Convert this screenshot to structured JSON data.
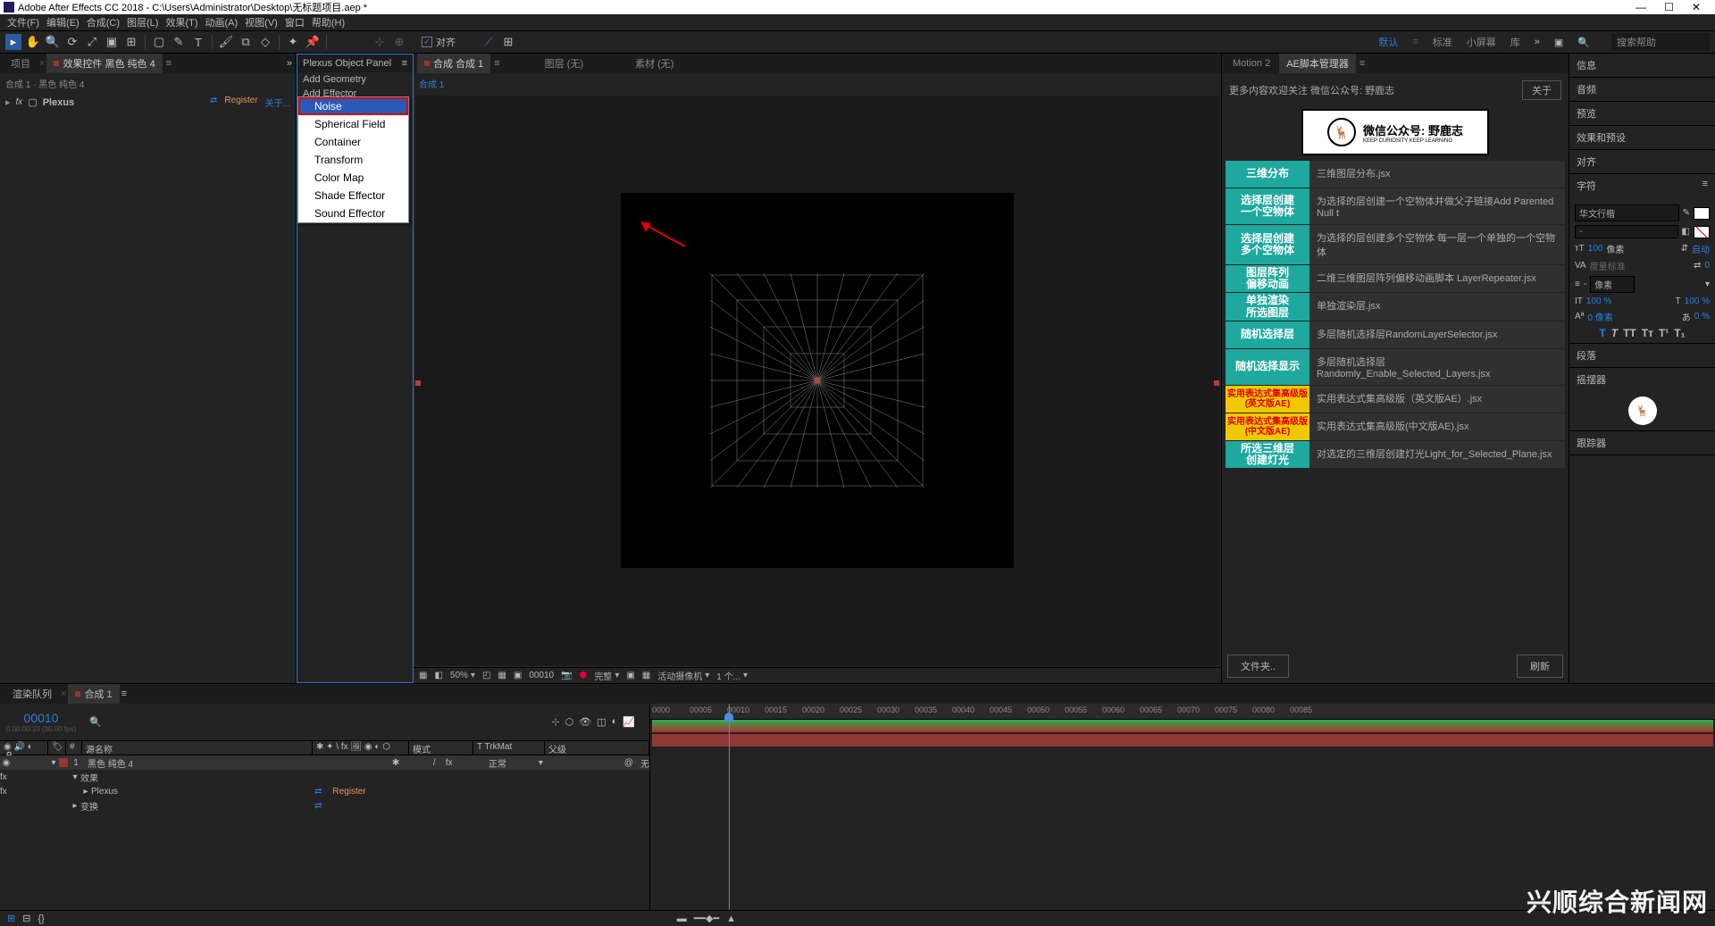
{
  "title_bar": {
    "text": "Adobe After Effects CC 2018 - C:\\Users\\Administrator\\Desktop\\无标题项目.aep *"
  },
  "menu": [
    "文件(F)",
    "编辑(E)",
    "合成(C)",
    "图层(L)",
    "效果(T)",
    "动画(A)",
    "视图(V)",
    "窗口",
    "帮助(H)"
  ],
  "toolbar": {
    "align_label": "对齐"
  },
  "workspaces": {
    "items": [
      "默认",
      "标准",
      "小屏幕",
      "库"
    ],
    "active": 0,
    "search_placeholder": "搜索帮助"
  },
  "project_panel": {
    "tabs": {
      "project": "项目",
      "effect_controls": "效果控件 黑色 纯色 4"
    },
    "breadcrumb": "合成 1 · 黑色 纯色 4",
    "plexus_name": "Plexus",
    "register": "Register",
    "about": "关于..."
  },
  "plexus_object_panel": {
    "title": "Plexus Object Panel",
    "add_geometry": "Add Geometry",
    "add_effector": "Add Effector",
    "effectors": [
      "Noise",
      "Spherical Field",
      "Container",
      "Transform",
      "Color Map",
      "Shade Effector",
      "Sound Effector"
    ],
    "highlighted": 0
  },
  "comp_panel": {
    "tabs": {
      "comp": "合成 合成 1",
      "layer": "图层 (无)",
      "footage": "素材 (无)"
    },
    "breadcrumb": "合成 1",
    "bottom": {
      "zoom": "50%",
      "frame": "00010",
      "quality": "完整",
      "camera": "活动摄像机",
      "views": "1 个..."
    }
  },
  "script_panel": {
    "tabs": {
      "motion": "Motion 2",
      "manager": "AE脚本管理器"
    },
    "notice": "更多内容欢迎关注 微信公众号: 野鹿志",
    "about": "关于",
    "logo_text": "微信公众号: 野鹿志",
    "logo_sub": "KEEP CURIOSITY KEEP LEARNING",
    "rows": [
      {
        "btn": "三维分布",
        "desc": "三维图层分布.jsx",
        "cls": ""
      },
      {
        "btn": "选择层创建\n一个空物体",
        "desc": "为选择的层创建一个空物体并做父子链接Add Parented Null t",
        "cls": ""
      },
      {
        "btn": "选择层创建\n多个空物体",
        "desc": "为选择的层创建多个空物体 每一层一个单独的一个空物体",
        "cls": ""
      },
      {
        "btn": "图层阵列\n偏移动画",
        "desc": "二维三维图层阵列偏移动画脚本 LayerRepeater.jsx",
        "cls": ""
      },
      {
        "btn": "单独渲染\n所选图层",
        "desc": "单独渲染层.jsx",
        "cls": ""
      },
      {
        "btn": "随机选择层",
        "desc": "多层随机选择层RandomLayerSelector.jsx",
        "cls": ""
      },
      {
        "btn": "随机选择显示",
        "desc": "多层随机选择层Randomly_Enable_Selected_Layers.jsx",
        "cls": ""
      },
      {
        "btn": "实用表达式集高级版\n(英文版AE)",
        "desc": "实用表达式集高级版（英文版AE）.jsx",
        "cls": "yellow"
      },
      {
        "btn": "实用表达式集高级版\n(中文版AE)",
        "desc": "实用表达式集高级版(中文版AE).jsx",
        "cls": "yellow"
      },
      {
        "btn": "所选三维层\n创建灯光",
        "desc": "对选定的三维层创建灯光Light_for_Selected_Plane.jsx",
        "cls": ""
      }
    ],
    "footer": {
      "folder": "文件夹..",
      "refresh": "刷新"
    }
  },
  "side_panels": {
    "headers": [
      "信息",
      "音频",
      "预览",
      "效果和预设",
      "对齐",
      "字符",
      "段落",
      "摇摆器",
      "跟踪器"
    ],
    "char": {
      "font": "华文行楷",
      "font_size": "100",
      "px_label": "像素",
      "auto": "自动",
      "tracking_label": "度量标准",
      "leading": "-",
      "scale_h": "100 %",
      "scale_v": "100 %",
      "baseline": "0 像素",
      "stroke": "0 %",
      "px_unit": "像素"
    }
  },
  "timeline": {
    "tabs": {
      "render": "渲染队列",
      "comp": "合成 1"
    },
    "timecode": "00010",
    "timecode_sub": "0:00:00:10 (30.00 fps)",
    "columns": {
      "source": "源名称",
      "mode": "模式",
      "trkmat": "T  TrkMat",
      "parent": "父级"
    },
    "layers": [
      {
        "num": "1",
        "color": "#a03030",
        "name": "黑色 纯色 4",
        "mode": "正常",
        "parent": "无"
      }
    ],
    "sublayers": {
      "effects": "效果",
      "plexus": "Plexus",
      "register": "Register",
      "transform": "变换"
    },
    "ruler_ticks": [
      "0000",
      "00005",
      "00010",
      "00015",
      "00020",
      "00025",
      "00030",
      "00035",
      "00040",
      "00045",
      "00050",
      "00055",
      "00060",
      "00065",
      "00070",
      "00075",
      "00080",
      "00085"
    ]
  },
  "watermark": "兴顺综合新闻网"
}
